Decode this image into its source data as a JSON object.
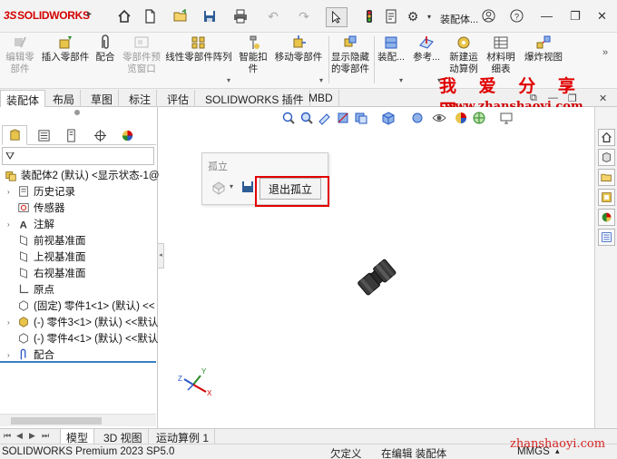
{
  "app": {
    "brand_ds": "3S",
    "brand_name": "SOLIDWORKS",
    "document_title": "装配体..."
  },
  "command_manager": {
    "items": [
      {
        "label": "编辑零\n部件",
        "disabled": true
      },
      {
        "label": "插入零部件",
        "disabled": false
      },
      {
        "label": "配合",
        "disabled": false
      },
      {
        "label": "零部件预\n览窗口",
        "disabled": true
      },
      {
        "label": "线性零部件阵列",
        "disabled": false
      },
      {
        "label": "智能扣\n件",
        "disabled": false
      },
      {
        "label": "移动零部件",
        "disabled": false
      },
      {
        "label": "显示隐藏\n的零部件",
        "disabled": false
      },
      {
        "label": "装配...",
        "disabled": false
      },
      {
        "label": "参考...",
        "disabled": false
      },
      {
        "label": "新建运\n动算例",
        "disabled": false
      },
      {
        "label": "材料明\n细表",
        "disabled": false
      },
      {
        "label": "爆炸视图",
        "disabled": false
      }
    ]
  },
  "tabs": [
    "装配体",
    "布局",
    "草图",
    "标注",
    "评估",
    "SOLIDWORKS 插件",
    "MBD"
  ],
  "watermark": {
    "cn": "我 爱 分 享 网",
    "url": "www.zhanshaoyi.com",
    "bottom_url": "zhanshaoyi.com"
  },
  "tree": {
    "root": "装配体2 (默认) <显示状态-1@",
    "items": [
      {
        "label": "历史记录",
        "expandable": true
      },
      {
        "label": "传感器",
        "expandable": false
      },
      {
        "label": "注解",
        "expandable": true
      },
      {
        "label": "前视基准面",
        "expandable": false
      },
      {
        "label": "上视基准面",
        "expandable": false
      },
      {
        "label": "右视基准面",
        "expandable": false
      },
      {
        "label": "原点",
        "expandable": false
      },
      {
        "label": "(固定) 零件1<1> (默认) <<",
        "expandable": false
      },
      {
        "label": "(-) 零件3<1> (默认) <<默认",
        "expandable": true
      },
      {
        "label": "(-) 零件4<1> (默认) <<默认",
        "expandable": false
      },
      {
        "label": "配合",
        "expandable": true
      }
    ]
  },
  "isolate": {
    "title": "孤立",
    "exit_label": "退出孤立"
  },
  "triad": {
    "x": "X",
    "y": "Y",
    "z": "Z"
  },
  "bottom_tabs": [
    "模型",
    "3D 视图",
    "运动算例 1"
  ],
  "status": {
    "product": "SOLIDWORKS Premium 2023 SP5.0",
    "underdefined": "欠定义",
    "editing": "在编辑 装配体",
    "units": "MMGS"
  }
}
